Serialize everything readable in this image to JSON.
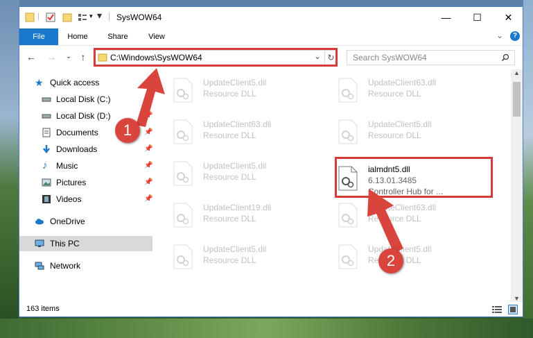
{
  "window": {
    "title": "SysWOW64",
    "minimize": "—",
    "maximize": "☐",
    "close": "✕"
  },
  "ribbon": {
    "tabs": [
      "File",
      "Home",
      "Share",
      "View"
    ],
    "expand": "⌄",
    "help": "?"
  },
  "address": {
    "path": "C:\\Windows\\SysWOW64",
    "dropdown": "⌄",
    "refresh": "↻",
    "search_placeholder": "Search SysWOW64"
  },
  "nav": {
    "quick_access": "Quick access",
    "items": [
      {
        "label": "Local Disk (C:)",
        "icon": "drive-icon",
        "pinned": true
      },
      {
        "label": "Local Disk (D:)",
        "icon": "drive-icon",
        "pinned": true
      },
      {
        "label": "Documents",
        "icon": "documents-icon",
        "pinned": true
      },
      {
        "label": "Downloads",
        "icon": "downloads-icon",
        "pinned": true
      },
      {
        "label": "Music",
        "icon": "music-icon",
        "pinned": true
      },
      {
        "label": "Pictures",
        "icon": "pictures-icon",
        "pinned": true
      },
      {
        "label": "Videos",
        "icon": "videos-icon",
        "pinned": true
      }
    ],
    "onedrive": "OneDrive",
    "this_pc": "This PC",
    "network": "Network"
  },
  "files": {
    "left_column": [
      {
        "name": "UpdateClient5.dll",
        "type": "Resource DLL"
      },
      {
        "name": "UpdateClient63.dll",
        "type": "Resource DLL"
      },
      {
        "name": "UpdateClient5.dll",
        "type": "Resource DLL"
      },
      {
        "name": "UpdateClient19.dll",
        "type": "Resource DLL"
      },
      {
        "name": "UpdateClient5.dll",
        "type": "Resource DLL"
      }
    ],
    "right_column": [
      {
        "name": "UpdateClient63.dll",
        "type": "Resource DLL"
      },
      {
        "name": "UpdateClient5.dll",
        "type": "Resource DLL"
      },
      {
        "name": "UpdateClient63.dll",
        "type": "Resource DLL"
      },
      {
        "name": "UpdateClient5.dll",
        "type": "Resource DLL"
      }
    ],
    "selected": {
      "name": "ialmdnt5.dll",
      "version": "6.13.01.3485",
      "description": "Controller Hub for ..."
    }
  },
  "status": {
    "count": "163 items"
  },
  "annotations": {
    "step1": "1",
    "step2": "2"
  },
  "colors": {
    "accent": "#1979ca",
    "highlight_box": "#d63a3a",
    "badge": "#d9453c"
  }
}
